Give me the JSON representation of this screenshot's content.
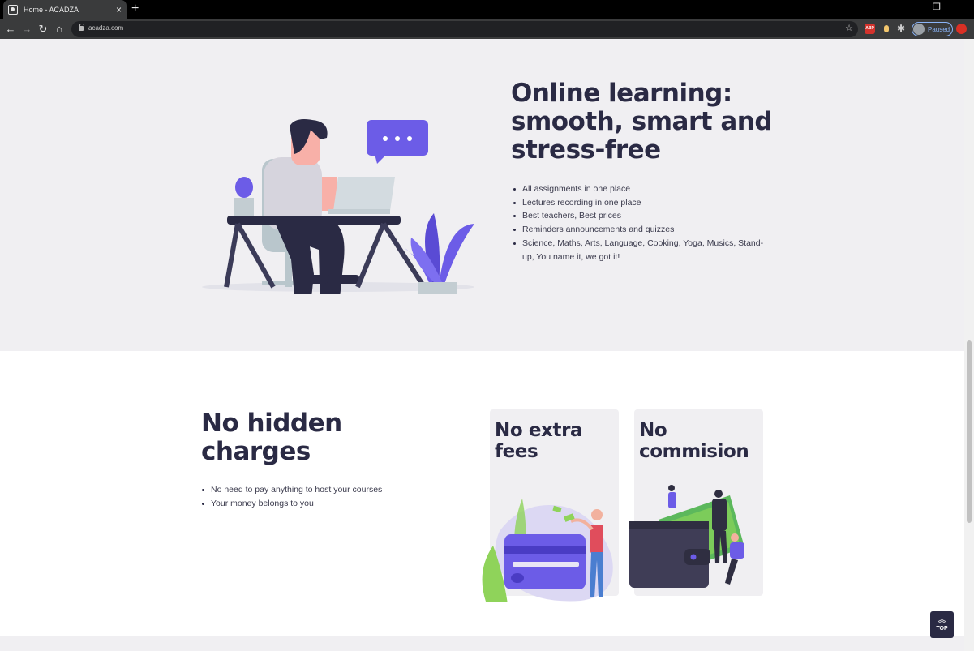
{
  "browser": {
    "tab_title": "Home - ACADZA",
    "tab_close": "×",
    "new_tab": "+",
    "url": "acadza.com",
    "profile_label": "Paused",
    "ext_badge": "ABP",
    "back": "←",
    "forward": "→",
    "reload": "↻",
    "home": "⌂",
    "bookmark": "☆",
    "puzzle": "✱",
    "window_controls": [
      "❐",
      "─",
      "✕"
    ]
  },
  "hero": {
    "title": "Online learning: smooth, smart and stress-free",
    "features": [
      "All assignments in one place",
      "Lectures recording in one place",
      "Best teachers, Best prices",
      "Reminders announcements and quizzes",
      "Science, Maths, Arts, Language, Cooking, Yoga, Musics, Stand-up, You name it, we got it!"
    ]
  },
  "pricing": {
    "title": "No hidden charges",
    "points": [
      "No need to pay anything to host your courses",
      "Your money belongs to you"
    ],
    "cards": [
      {
        "title": "No extra fees"
      },
      {
        "title": "No commision"
      }
    ]
  },
  "top_button": {
    "icon": "︽",
    "label": "TOP"
  },
  "colors": {
    "accent": "#6c5ce7",
    "heading": "#2a2a44",
    "hero_bg": "#f0eff2",
    "section_bg": "#ffffff"
  }
}
